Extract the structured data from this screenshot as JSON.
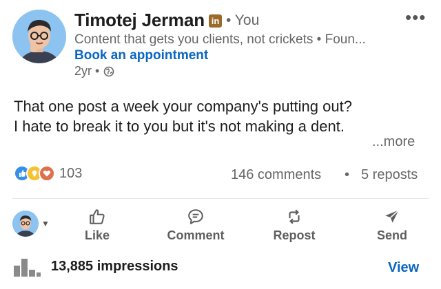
{
  "author": {
    "name": "Timotej Jerman",
    "badge": "in",
    "degree": "• You",
    "headline": "Content that gets you clients, not crickets • Foun...",
    "cta": "Book an appointment",
    "age": "2yr •",
    "visibility_icon": "globe-icon"
  },
  "menu": {
    "more_label": "•••"
  },
  "post": {
    "line1": "That one post a week your company's putting out?",
    "line2": "I hate to break it to you but it's not making a dent.",
    "see_more": "...more"
  },
  "social": {
    "reactions": [
      "like-icon",
      "insightful-icon",
      "love-icon"
    ],
    "reaction_count": "103",
    "comments": "146 comments",
    "separator": "•",
    "reposts": "5 reposts"
  },
  "actions": {
    "like": "Like",
    "comment": "Comment",
    "repost": "Repost",
    "send": "Send"
  },
  "impressions": {
    "text": "13,885 impressions",
    "view": "View"
  },
  "colors": {
    "link": "#0a66c2",
    "muted": "#666666",
    "like": "#378fe9",
    "insightful": "#f5c32f",
    "love": "#df704d"
  }
}
